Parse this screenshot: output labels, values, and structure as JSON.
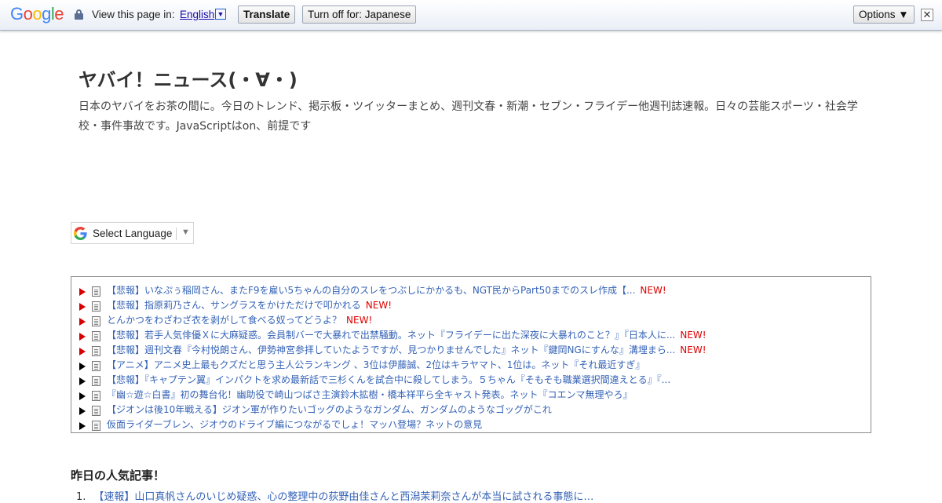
{
  "translate_bar": {
    "logo_letters": [
      {
        "ch": "G",
        "color": "#4285F4"
      },
      {
        "ch": "o",
        "color": "#EA4335"
      },
      {
        "ch": "o",
        "color": "#FBBC05"
      },
      {
        "ch": "g",
        "color": "#4285F4"
      },
      {
        "ch": "l",
        "color": "#34A853"
      },
      {
        "ch": "e",
        "color": "#EA4335"
      }
    ],
    "view_text": "View this page in:",
    "language": "English",
    "language_dropdown": "▼",
    "translate_label": "Translate",
    "turn_off_label": "Turn off for: Japanese",
    "options_label": "Options ▼",
    "close_label": "✕"
  },
  "site": {
    "title": "ヤバイ！ニュース(・∀・)",
    "description": "日本のヤバイをお茶の間に。今日のトレンド、掲示板・ツイッターまとめ、週刊文春・新潮・セブン・フライデー他週刊誌速報。日々の芸能スポーツ・社会学校・事件事故です。JavaScriptはon、前提です"
  },
  "language_selector": {
    "label": "Select Language",
    "arrow": "▼"
  },
  "news": {
    "new_label": "NEW!",
    "items": [
      {
        "title": "【悲報】いなぷぅ稲岡さん、またF9を雇い5ちゃんの自分のスレをつぶしにかかるも、NGT民からPart50までのスレ作成【...",
        "is_new": true
      },
      {
        "title": "【悲報】指原莉乃さん、サングラスをかけただけで叩かれる",
        "is_new": true
      },
      {
        "title": "とんかつをわざわざ衣を剥がして食べる奴ってどうよ？",
        "is_new": true
      },
      {
        "title": "【悲報】若手人気俳優Ｘに大麻疑惑。会員制バーで大暴れで出禁騒動。ネット『フライデーに出た深夜に大暴れのこと？』『日本人に...",
        "is_new": true
      },
      {
        "title": "【悲報】週刊文春『今村悦朗さん、伊勢神宮参拝していたようですが、見つかりませんでした』ネット『鍵岡NGにすんな』溝埋まら...",
        "is_new": true
      },
      {
        "title": "【アニメ】アニメ史上最もクズだと思う主人公ランキング 、3位は伊藤誠、2位はキラヤマト、1位は。ネット『それ最近すぎ』",
        "is_new": false
      },
      {
        "title": "【悲報】『キャプテン翼』インパクトを求め最新話で三杉くんを試合中に殺してしまう。５ちゃん『そもそも職業選択間違えとる』『...",
        "is_new": false
      },
      {
        "title": "『幽☆遊☆白書』初の舞台化！幽助役で崎山つばさ主演鈴木拡樹・橋本祥平ら全キャスト発表。ネット『コエンマ無理やろ』",
        "is_new": false
      },
      {
        "title": "【ジオンは後10年戦える】ジオン軍が作りたいゴッグのようなガンダム、ガンダムのようなゴッグがこれ",
        "is_new": false
      },
      {
        "title": "仮面ライダーブレン、ジオウのドライブ編につながるでしょ！マッハ登場？ネットの意見",
        "is_new": false
      }
    ]
  },
  "popular": {
    "heading": "昨日の人気記事！",
    "first_item_number": "1.",
    "first_item_title": "【速報】山口真帆さんのいじめ疑惑、心の整理中の荻野由佳さんと西潟茉莉奈さんが本当に試される事態に…"
  }
}
